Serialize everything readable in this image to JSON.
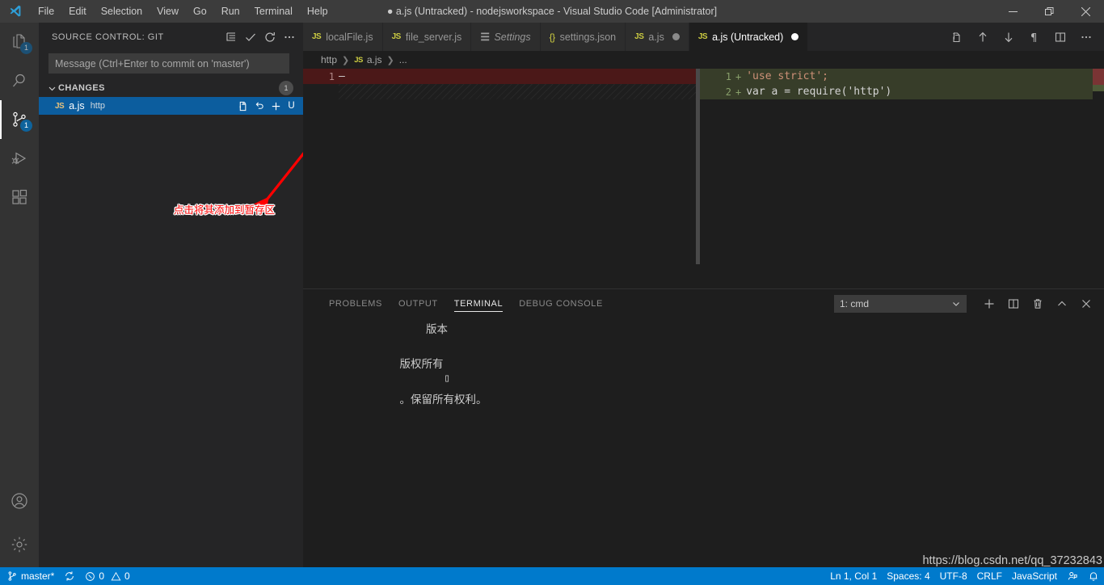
{
  "window": {
    "title": "● a.js (Untracked) - nodejsworkspace - Visual Studio Code [Administrator]",
    "minimize_label": "Minimize",
    "restore_label": "Restore",
    "close_label": "Close"
  },
  "menu": {
    "items": [
      {
        "label": "File"
      },
      {
        "label": "Edit"
      },
      {
        "label": "Selection"
      },
      {
        "label": "View"
      },
      {
        "label": "Go"
      },
      {
        "label": "Run"
      },
      {
        "label": "Terminal"
      },
      {
        "label": "Help"
      }
    ]
  },
  "activity_bar": {
    "items": [
      {
        "name": "explorer",
        "icon": "files-icon",
        "badge": "1",
        "active": false
      },
      {
        "name": "search",
        "icon": "search-icon",
        "badge": "",
        "active": false
      },
      {
        "name": "source-control",
        "icon": "source-control-icon",
        "badge": "1",
        "active": true
      },
      {
        "name": "run-debug",
        "icon": "run-debug-icon",
        "badge": "",
        "active": false
      },
      {
        "name": "extensions",
        "icon": "extensions-icon",
        "badge": "",
        "active": false
      }
    ],
    "bottom_items": [
      {
        "name": "accounts",
        "icon": "account-icon"
      },
      {
        "name": "manage",
        "icon": "gear-icon"
      }
    ]
  },
  "sidebar": {
    "title": "SOURCE CONTROL: GIT",
    "actions": [
      {
        "name": "view-as-tree",
        "icon": "list-icon"
      },
      {
        "name": "commit",
        "icon": "check-icon"
      },
      {
        "name": "refresh",
        "icon": "refresh-icon"
      },
      {
        "name": "more-actions",
        "icon": "ellipsis-icon"
      }
    ],
    "commit_input": {
      "placeholder": "Message (Ctrl+Enter to commit on 'master')",
      "value": ""
    },
    "changes_section": {
      "label": "CHANGES",
      "count": "1",
      "expanded": true
    },
    "changes": [
      {
        "file_icon": "JS",
        "name": "a.js",
        "path": "http",
        "status": "U",
        "selected": true,
        "actions": [
          {
            "name": "open-file",
            "icon": "open-file-icon"
          },
          {
            "name": "discard-changes",
            "icon": "discard-icon"
          },
          {
            "name": "stage-changes",
            "icon": "plus-icon"
          }
        ]
      }
    ],
    "annotation": {
      "text": "点击将其添加到暂存区",
      "color": "#ff0000"
    }
  },
  "editor": {
    "tabs": [
      {
        "label": "localFile.js",
        "icon": "js-icon",
        "active": false,
        "dirty": false,
        "italic": false
      },
      {
        "label": "file_server.js",
        "icon": "js-icon",
        "active": false,
        "dirty": false,
        "italic": false
      },
      {
        "label": "Settings",
        "icon": "settings-icon",
        "active": false,
        "dirty": false,
        "italic": true
      },
      {
        "label": "settings.json",
        "icon": "json-icon",
        "active": false,
        "dirty": false,
        "italic": false
      },
      {
        "label": "a.js",
        "icon": "js-icon",
        "active": false,
        "dirty": true,
        "italic": false
      },
      {
        "label": "a.js (Untracked)",
        "icon": "js-icon",
        "active": true,
        "dirty": true,
        "italic": false
      }
    ],
    "tab_actions": [
      {
        "name": "swap-diff-sides",
        "icon": "compare-icon"
      },
      {
        "name": "previous-change",
        "icon": "arrow-up-icon"
      },
      {
        "name": "next-change",
        "icon": "arrow-down-icon"
      },
      {
        "name": "toggle-whitespace",
        "icon": "pilcrow-icon"
      },
      {
        "name": "split-editor",
        "icon": "split-editor-icon"
      },
      {
        "name": "more-actions",
        "icon": "ellipsis-icon"
      }
    ],
    "breadcrumb": [
      {
        "label": "http",
        "icon": ""
      },
      {
        "label": "a.js",
        "icon": "js-icon"
      },
      {
        "label": "...",
        "icon": ""
      }
    ],
    "diff_left": {
      "lines": [
        {
          "num": "1",
          "marker": "—",
          "text": "",
          "type": "deleted"
        }
      ]
    },
    "diff_right": {
      "lines": [
        {
          "num": "1",
          "marker": "+",
          "text": "'use strict';",
          "type": "inserted"
        },
        {
          "num": "2",
          "marker": "+",
          "text": "var a = require('http')",
          "type": "inserted"
        }
      ]
    }
  },
  "panel": {
    "tabs": [
      {
        "label": "PROBLEMS",
        "active": false
      },
      {
        "label": "OUTPUT",
        "active": false
      },
      {
        "label": "TERMINAL",
        "active": true
      },
      {
        "label": "DEBUG CONSOLE",
        "active": false
      }
    ],
    "terminal_select": {
      "value": "1: cmd",
      "chevron": "chevron-down-icon"
    },
    "actions": [
      {
        "name": "new-terminal",
        "icon": "plus-icon"
      },
      {
        "name": "split-terminal",
        "icon": "split-icon"
      },
      {
        "name": "kill-terminal",
        "icon": "trash-icon"
      },
      {
        "name": "maximize-panel",
        "icon": "chevron-up-icon"
      },
      {
        "name": "close-panel",
        "icon": "close-icon"
      }
    ],
    "terminal_output": {
      "line1": "版本",
      "line2_left": "版权所有",
      "line2_right": "。保留所有权利。",
      "line3": "▯"
    }
  },
  "status_bar": {
    "left": [
      {
        "name": "git-branch",
        "icon": "branch-icon",
        "label": "master*"
      },
      {
        "name": "sync-changes",
        "icon": "sync-icon",
        "label": ""
      },
      {
        "name": "problems",
        "icon": "error-warning-icon",
        "label": "0 0",
        "errors": "0",
        "warnings": "0"
      }
    ],
    "right": [
      {
        "name": "editor-position",
        "label": "Ln 1, Col 1"
      },
      {
        "name": "editor-indentation",
        "label": "Spaces: 4"
      },
      {
        "name": "editor-encoding",
        "label": "UTF-8"
      },
      {
        "name": "editor-eol",
        "label": "CRLF"
      },
      {
        "name": "editor-language",
        "label": "JavaScript"
      },
      {
        "name": "feedback",
        "icon": "feedback-icon",
        "label": ""
      },
      {
        "name": "notifications",
        "icon": "bell-icon",
        "label": ""
      }
    ]
  },
  "watermark": "https://blog.csdn.net/qq_37232843"
}
